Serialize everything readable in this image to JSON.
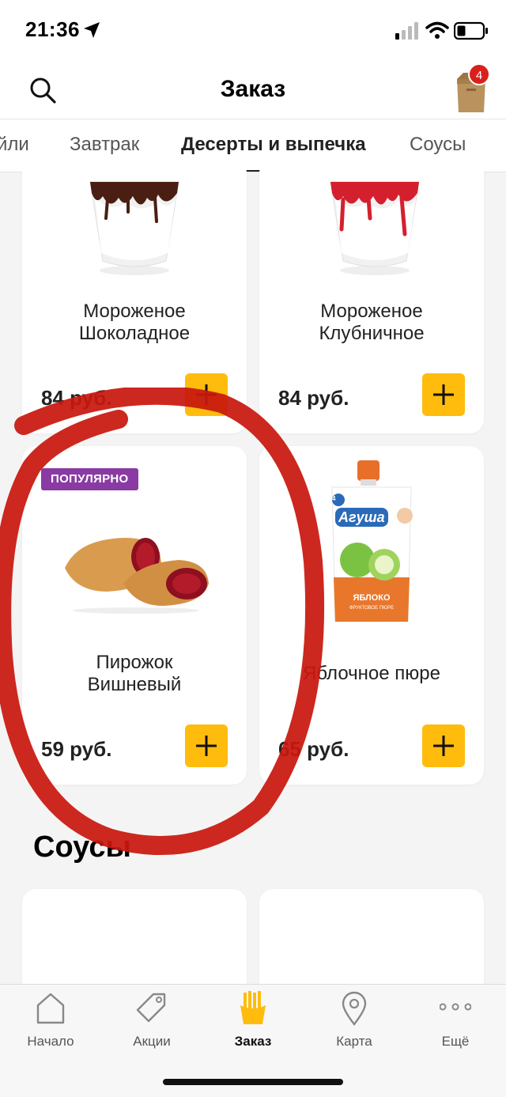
{
  "status_bar": {
    "time": "21:36"
  },
  "header": {
    "title": "Заказ",
    "cart_count": "4"
  },
  "tabs": [
    {
      "label": "йли"
    },
    {
      "label": "Завтрак"
    },
    {
      "label": "Десерты и выпечка",
      "active": true
    },
    {
      "label": "Соусы"
    }
  ],
  "products": [
    {
      "name_line1": "Мороженое",
      "name_line2": "Шоколадное",
      "price": "84 руб."
    },
    {
      "name_line1": "Мороженое",
      "name_line2": "Клубничное",
      "price": "84 руб."
    },
    {
      "badge": "ПОПУЛЯРНО",
      "name_line1": "Пирожок",
      "name_line2": "Вишневый",
      "price": "59 руб."
    },
    {
      "name_line1": "Яблочное пюре",
      "price": "65 руб.",
      "package_brand": "Агуша",
      "package_flavor": "ЯБЛОКО",
      "package_subtitle": "ФРУКТОВОЕ ПЮРЕ",
      "package_age": "4"
    }
  ],
  "sections": {
    "sauces_title": "Соусы"
  },
  "bottom_nav": [
    {
      "label": "Начало",
      "icon": "home-icon"
    },
    {
      "label": "Акции",
      "icon": "tag-icon"
    },
    {
      "label": "Заказ",
      "icon": "fries-icon",
      "active": true
    },
    {
      "label": "Карта",
      "icon": "map-pin-icon"
    },
    {
      "label": "Ещё",
      "icon": "more-icon"
    }
  ],
  "colors": {
    "accent_yellow": "#ffbc0d",
    "badge_purple": "#8a3aa3",
    "cart_badge_red": "#d9201c",
    "annotation_red": "#c8180e"
  }
}
